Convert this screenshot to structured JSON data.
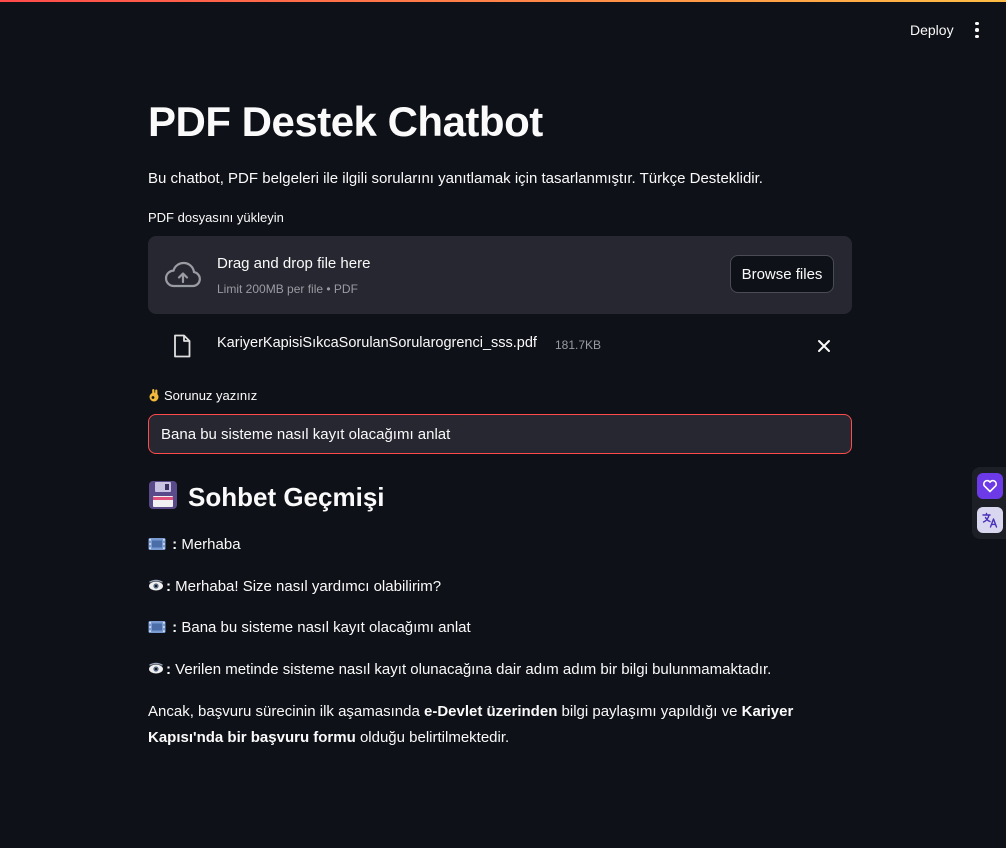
{
  "toolbar": {
    "deploy_label": "Deploy"
  },
  "page": {
    "title": "PDF Destek Chatbot",
    "description": "Bu chatbot, PDF belgeleri ile ilgili sorularını yanıtlamak için tasarlanmıştır. Türkçe Desteklidir."
  },
  "uploader": {
    "label": "PDF dosyasını yükleyin",
    "drop_title": "Drag and drop file here",
    "limit_text": "Limit 200MB per file • PDF",
    "browse_label": "Browse files",
    "file": {
      "name": "KariyerKapisiSıkcaSorulanSorularogrenci_sss.pdf",
      "size": "181.7KB"
    }
  },
  "question": {
    "label": "Sorunuz yazınız",
    "value": "Bana bu sisteme nasıl kayıt olacağımı anlat"
  },
  "history": {
    "title": "Sohbet Geçmişi",
    "messages": [
      {
        "prefix": " : ",
        "text": "Merhaba"
      },
      {
        "prefix": ": ",
        "text": "Merhaba! Size nasıl yardımcı olabilirim?"
      },
      {
        "prefix": " : ",
        "text": "Bana bu sisteme nasıl kayıt olacağımı anlat"
      },
      {
        "prefix": ": ",
        "text": "Verilen metinde sisteme nasıl kayıt olunacağına dair adım adım bir bilgi bulunmamaktadır."
      }
    ],
    "paragraph": {
      "part1": "Ancak, başvuru sürecinin ilk aşamasında ",
      "bold1": "e-Devlet üzerinden",
      "part2": " bilgi paylaşımı yapıldığı ve ",
      "bold2": "Kariyer Kapısı'nda bir başvuru formu",
      "part3": " olduğu belirtilmektedir."
    }
  },
  "colors": {
    "background": "#0e1117",
    "surface": "#262730",
    "accent": "#ff4b4b",
    "extension": "#6d3ae8"
  },
  "icons": {
    "cloud": "cloud-upload-icon",
    "file": "file-icon",
    "close": "close-icon",
    "user": "film-frames-icon",
    "bot": "eye-icon",
    "hand": "ok-hand-icon",
    "floppy": "floppy-disk-icon"
  }
}
